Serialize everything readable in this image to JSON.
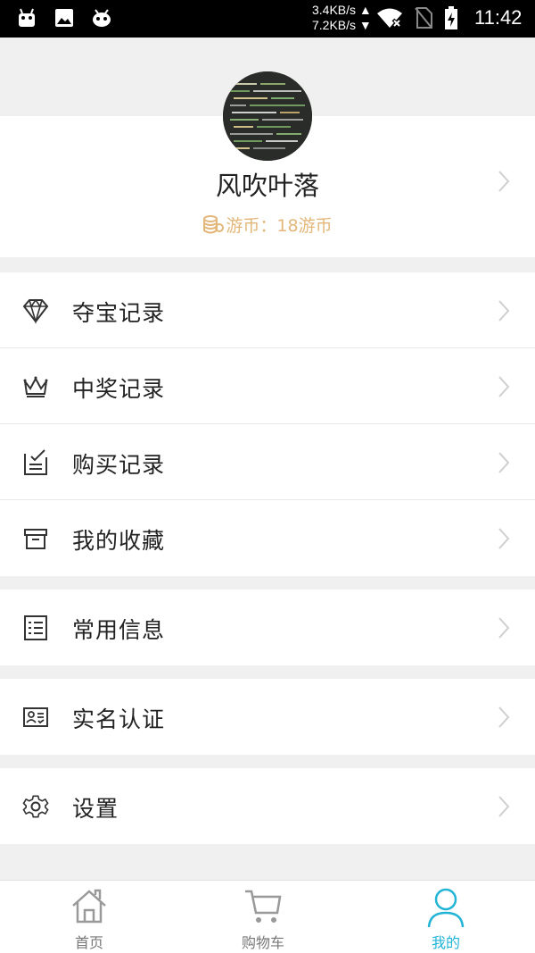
{
  "status_bar": {
    "upload_speed": "3.4KB/s",
    "download_speed": "7.2KB/s",
    "time": "11:42",
    "icons": [
      "android-icon",
      "gallery-icon",
      "android-icon",
      "wifi-off-icon",
      "no-sim-icon",
      "battery-charging-icon"
    ]
  },
  "profile": {
    "username": "风吹叶落",
    "coins_text": "游币：18游币",
    "coin_color": "#e3b77a"
  },
  "menu": {
    "group1": [
      {
        "label": "夺宝记录",
        "icon": "diamond-icon"
      },
      {
        "label": "中奖记录",
        "icon": "crown-icon"
      },
      {
        "label": "购买记录",
        "icon": "checklist-icon"
      },
      {
        "label": "我的收藏",
        "icon": "archive-box-icon"
      }
    ],
    "group2": [
      {
        "label": "常用信息",
        "icon": "list-icon"
      }
    ],
    "group3": [
      {
        "label": "实名认证",
        "icon": "id-card-icon"
      }
    ],
    "group4": [
      {
        "label": "设置",
        "icon": "gear-icon"
      }
    ]
  },
  "bottom_nav": {
    "tabs": [
      {
        "label": "首页",
        "icon": "home-icon",
        "active": false
      },
      {
        "label": "购物车",
        "icon": "cart-icon",
        "active": false
      },
      {
        "label": "我的",
        "icon": "user-icon",
        "active": true
      }
    ],
    "active_color": "#22b4d6"
  }
}
